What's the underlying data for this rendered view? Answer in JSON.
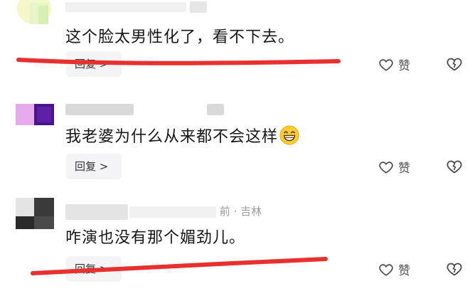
{
  "comments": [
    {
      "text": "这个脸太男性化了，看不下去。",
      "reply_label": "回复 >",
      "like_label": "赞"
    },
    {
      "text": "我老婆为什么从来都不会这样",
      "reply_label": "回复 >",
      "like_label": "赞"
    },
    {
      "meta_suffix": "前 · 吉林",
      "text": "咋演也没有那个媚劲儿。",
      "reply_label": "回复 >",
      "like_label": "赞"
    }
  ],
  "icons": {
    "like": "heart-outline-icon",
    "dislike": "broken-heart-icon",
    "emoji": "grinning-face-icon"
  },
  "colors": {
    "annotation_red": "#e8302f",
    "reply_bg": "#f4f4f6",
    "meta_gray": "#9a9a9a"
  }
}
